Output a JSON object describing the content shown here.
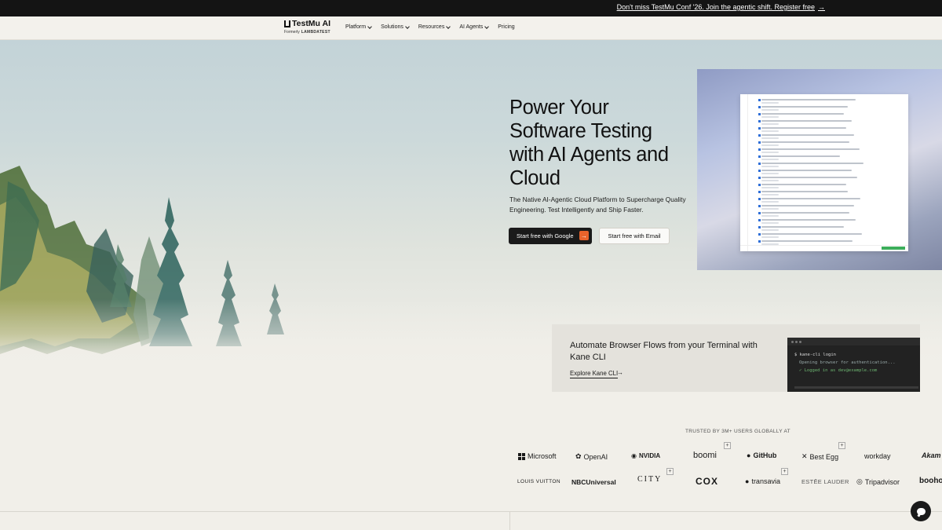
{
  "announcement": {
    "text": "Don't miss TestMu Conf '26. Join the agentic shift. Register free",
    "arrow": "→"
  },
  "nav": {
    "logo_name": "TestMu AI",
    "logo_formerly": "Formerly",
    "logo_old_brand": "LAMBDATEST",
    "items": [
      {
        "label": "Platform",
        "has_dropdown": true
      },
      {
        "label": "Solutions",
        "has_dropdown": true
      },
      {
        "label": "Resources",
        "has_dropdown": true
      },
      {
        "label": "AI Agents",
        "has_dropdown": true
      },
      {
        "label": "Pricing",
        "has_dropdown": false
      }
    ]
  },
  "hero": {
    "headline": "Power Your Software Testing with AI Agents and Cloud",
    "subtext": "The Native AI-Agentic Cloud Platform to Supercharge Quality Engineering. Test Intelligently and Ship Faster.",
    "btn_google": "Start free with Google",
    "btn_email": "Start free with Email"
  },
  "cli": {
    "title": "Automate Browser Flows from your Terminal with Kane CLI",
    "link": "Explore Kane CLI",
    "arrow": "→",
    "terminal": {
      "line1": "$ kane-cli login",
      "line2": "Opening browser for authentication...",
      "line3": "✓ Logged in as dev@example.com"
    }
  },
  "trusted": {
    "heading": "TRUSTED BY 3M+ USERS GLOBALLY AT",
    "row1": [
      "Microsoft",
      "OpenAI",
      "NVIDIA",
      "boomi",
      "GitHub",
      "Best Egg",
      "workday",
      "Akam"
    ],
    "row2": [
      "LOUIS VUITTON",
      "NBCUniversal",
      "CITY",
      "COX",
      "transavia",
      "ESTĒE LAUDER",
      "Tripadvisor",
      "booho"
    ]
  },
  "colors": {
    "accent": "#e8632b",
    "dark": "#1a1a1a",
    "background": "#f1efe9"
  }
}
